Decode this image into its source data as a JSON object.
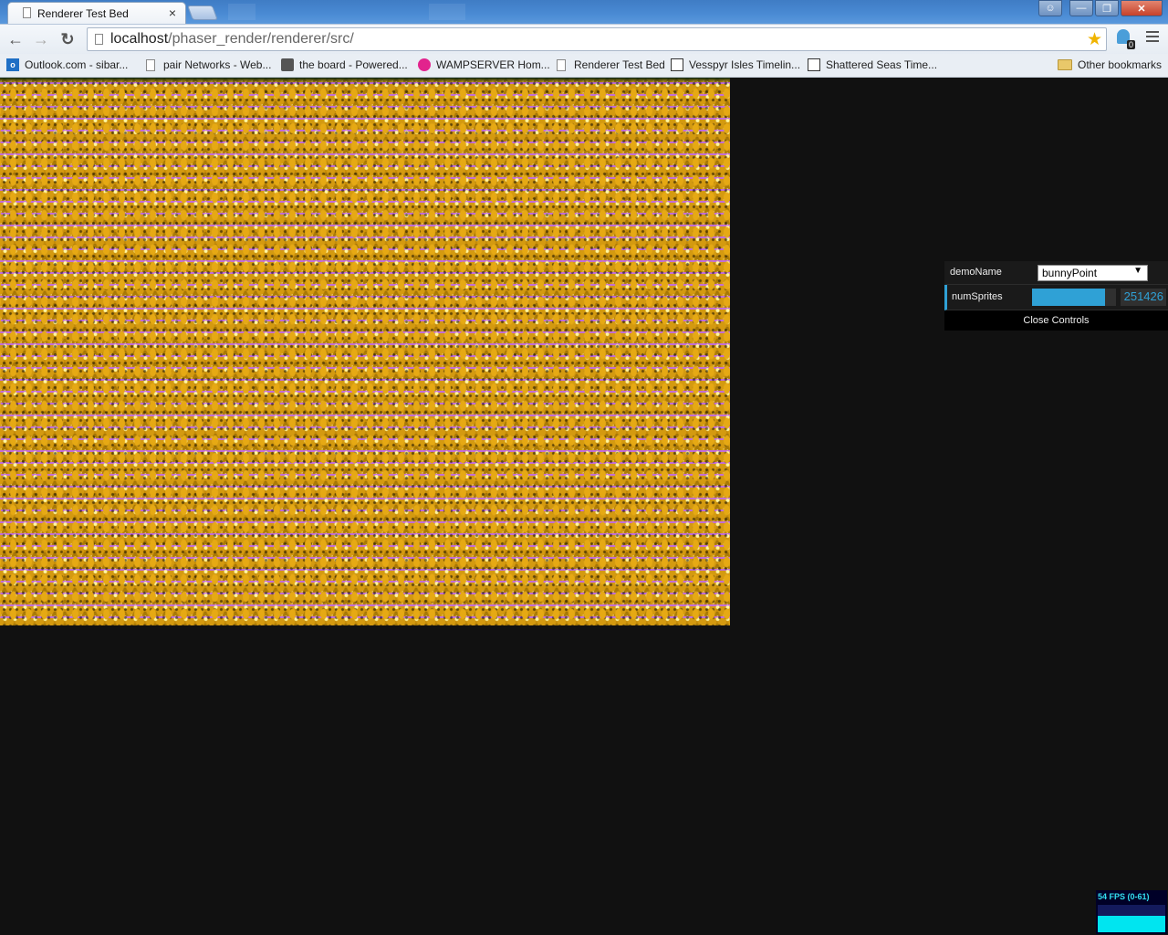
{
  "browser": {
    "tab": {
      "title": "Renderer Test Bed",
      "close": "×"
    },
    "url": {
      "host": "localhost",
      "path": "/phaser_render/renderer/src/"
    },
    "extension_badge": "0",
    "bookmarks": [
      {
        "label": "Outlook.com - sibar...",
        "icon": "outlook-icon"
      },
      {
        "label": "pair Networks - Web...",
        "icon": "page-icon"
      },
      {
        "label": "the board - Powered...",
        "icon": "board-icon"
      },
      {
        "label": "WAMPSERVER Hom...",
        "icon": "wamp-icon"
      },
      {
        "label": "Renderer Test Bed",
        "icon": "page-icon"
      },
      {
        "label": "Vesspyr Isles Timelin...",
        "icon": "clock-icon"
      },
      {
        "label": "Shattered Seas Time...",
        "icon": "clock-icon"
      }
    ],
    "other_bookmarks": "Other bookmarks"
  },
  "controls": {
    "demo_label": "demoName",
    "demo_value": "bunnyPoint",
    "sprites_label": "numSprites",
    "sprites_value": "251426",
    "sprites_fill_fraction": 0.87,
    "close_label": "Close Controls"
  },
  "fps": {
    "text": "54 FPS (0-61)",
    "level_fraction": 0.6
  },
  "colors": {
    "accent": "#2fa1d6",
    "page_background": "#111111",
    "fps_bar": "#00e5f0"
  }
}
